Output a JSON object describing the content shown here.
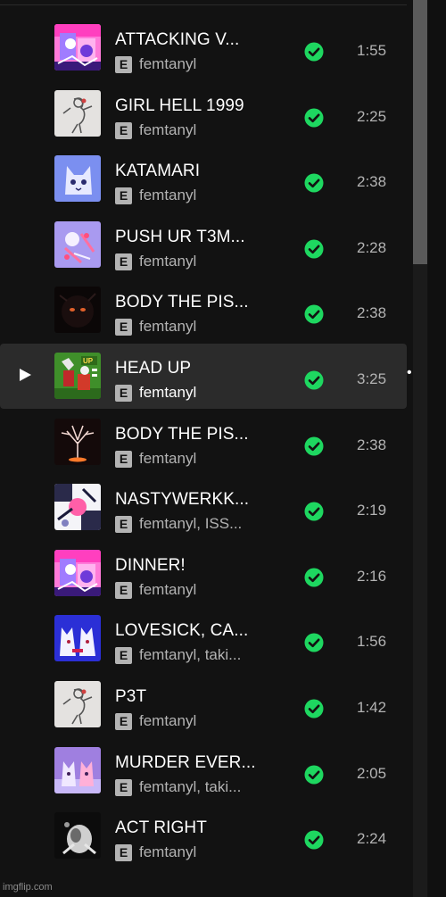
{
  "tracks": [
    {
      "title": "ATTACKING V...",
      "artist": "femtanyl",
      "duration": "1:55",
      "explicit": "E",
      "art": "pink-collage"
    },
    {
      "title": "GIRL HELL 1999",
      "artist": "femtanyl",
      "duration": "2:25",
      "explicit": "E",
      "art": "white-sketch"
    },
    {
      "title": "KATAMARI",
      "artist": "femtanyl",
      "duration": "2:38",
      "explicit": "E",
      "art": "blue-cat"
    },
    {
      "title": "PUSH UR T3M...",
      "artist": "femtanyl",
      "duration": "2:28",
      "explicit": "E",
      "art": "lilac-doodle"
    },
    {
      "title": "BODY THE PIS...",
      "artist": "femtanyl",
      "duration": "2:38",
      "explicit": "E",
      "art": "dark-eyes"
    },
    {
      "title": "HEAD UP",
      "artist": "femtanyl",
      "duration": "3:25",
      "explicit": "E",
      "art": "green-poster"
    },
    {
      "title": "BODY THE PIS...",
      "artist": "femtanyl",
      "duration": "2:38",
      "explicit": "E",
      "art": "dark-tree"
    },
    {
      "title": "NASTYWERKK...",
      "artist": "femtanyl, ISS...",
      "duration": "2:19",
      "explicit": "E",
      "art": "bw-collage"
    },
    {
      "title": "DINNER!",
      "artist": "femtanyl",
      "duration": "2:16",
      "explicit": "E",
      "art": "pink-collage"
    },
    {
      "title": "LOVESICK, CA...",
      "artist": "femtanyl, taki...",
      "duration": "1:56",
      "explicit": "E",
      "art": "blue-cats"
    },
    {
      "title": "P3T",
      "artist": "femtanyl",
      "duration": "1:42",
      "explicit": "E",
      "art": "white-sketch"
    },
    {
      "title": "MURDER EVER...",
      "artist": "femtanyl, taki...",
      "duration": "2:05",
      "explicit": "E",
      "art": "purple-cats"
    },
    {
      "title": "ACT RIGHT",
      "artist": "femtanyl",
      "duration": "2:24",
      "explicit": "E",
      "art": "dark-white"
    }
  ],
  "active_track": "HEAD UP",
  "icons": {
    "downloaded": "check-circle-icon",
    "play": "play-icon",
    "more": "more-options-icon"
  },
  "more_options_glyph": "•••",
  "colors": {
    "accent": "#1ed760",
    "background": "#121212",
    "row_active": "#2b2b2b",
    "text_secondary": "#b3b3b3"
  },
  "watermark": "imgflip.com"
}
